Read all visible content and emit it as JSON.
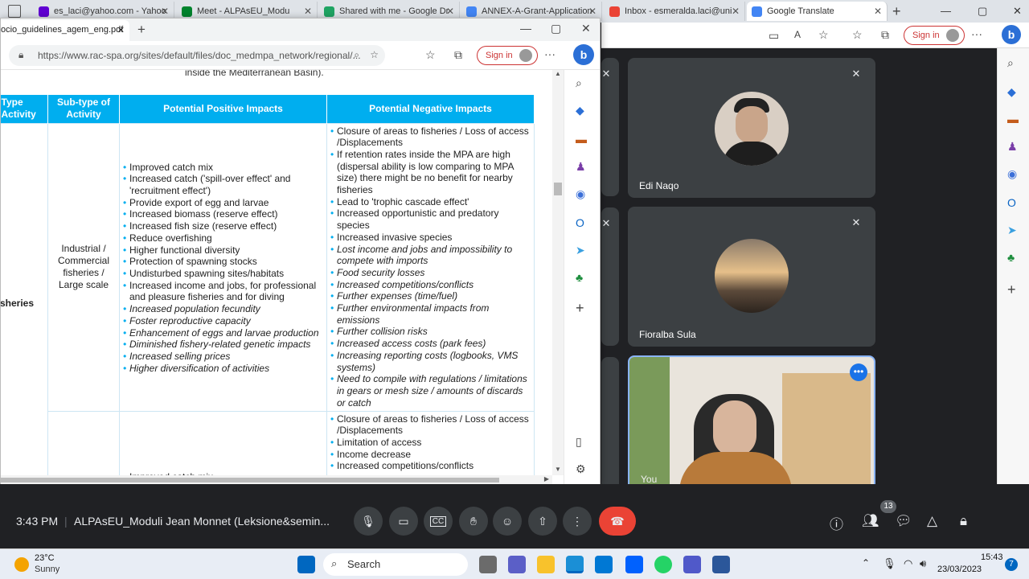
{
  "tabs": [
    {
      "label": "es_laci@yahoo.com - Yahoo",
      "icon": "yahoo-mail-icon",
      "color": "#6001d2"
    },
    {
      "label": "Meet - ALPAsEU_Modu",
      "icon": "google-meet-icon",
      "color": "#00832d"
    },
    {
      "label": "Shared with me - Google Dr",
      "icon": "google-drive-icon",
      "color": "#1fa463"
    },
    {
      "label": "ANNEX-A-Grant-Application",
      "icon": "google-docs-icon",
      "color": "#4285f4"
    },
    {
      "label": "Inbox - esmeralda.laci@uni",
      "icon": "gmail-icon",
      "color": "#ea4335"
    },
    {
      "label": "Google Translate",
      "icon": "google-translate-icon",
      "color": "#4285f4"
    }
  ],
  "pdf_window": {
    "tab_title": "ocio_guidelines_agem_eng.pdf",
    "url": "https://www.rac-spa.org/sites/default/files/doc_medmpa_network/regional/...",
    "signin": "Sign in",
    "intro_text": "inside the Mediterranean Basin).",
    "headers": [
      "Type Activity",
      "Sub-type of Activity",
      "Potential Positive Impacts",
      "Potential Negative Impacts"
    ],
    "type_label": "sheries",
    "row1": {
      "subtype": "Industrial / Commercial fisheries / Large scale",
      "positive": [
        {
          "t": "Improved catch mix",
          "i": false
        },
        {
          "t": "Increased catch ('spill-over effect' and 'recruitment effect')",
          "i": false
        },
        {
          "t": "Provide export of egg and larvae",
          "i": false
        },
        {
          "t": "Increased biomass (reserve effect)",
          "i": false
        },
        {
          "t": "Increased fish size (reserve effect)",
          "i": false
        },
        {
          "t": "Reduce overfishing",
          "i": false
        },
        {
          "t": "Higher functional diversity",
          "i": false
        },
        {
          "t": "Protection of spawning stocks",
          "i": false
        },
        {
          "t": "Undisturbed spawning sites/habitats",
          "i": false
        },
        {
          "t": "Increased income and jobs, for professional and pleasure fisheries and for diving",
          "i": false
        },
        {
          "t": "Increased population fecundity",
          "i": true
        },
        {
          "t": "Foster reproductive capacity",
          "i": true
        },
        {
          "t": "Enhancement of eggs and larvae production",
          "i": true
        },
        {
          "t": "Diminished fishery-related genetic impacts",
          "i": true
        },
        {
          "t": "Increased selling prices",
          "i": true
        },
        {
          "t": "Higher diversification of activities",
          "i": true
        }
      ],
      "negative": [
        {
          "t": "Closure of areas to fisheries / Loss of access /Displacements",
          "i": false
        },
        {
          "t": "If retention rates inside the MPA are high (dispersal ability is low comparing to MPA size) there might be no benefit for nearby fisheries",
          "i": false
        },
        {
          "t": "Lead to 'trophic cascade effect'",
          "i": false
        },
        {
          "t": "Increased opportunistic and predatory species",
          "i": false
        },
        {
          "t": "Increased invasive species",
          "i": false
        },
        {
          "t": "Lost income and jobs and impossibility to compete with imports",
          "i": true
        },
        {
          "t": "Food security losses",
          "i": true
        },
        {
          "t": "Increased competitions/conflicts",
          "i": true
        },
        {
          "t": "Further expenses (time/fuel)",
          "i": true
        },
        {
          "t": "Further environmental impacts from emissions",
          "i": true
        },
        {
          "t": "Further collision risks",
          "i": true
        },
        {
          "t": "Increased access costs (park fees)",
          "i": true
        },
        {
          "t": "Increasing reporting costs (logbooks, VMS systems)",
          "i": true
        },
        {
          "t": "Need to compile with regulations / limitations in gears or mesh size / amounts of discards or catch",
          "i": true
        }
      ]
    },
    "row2": {
      "positive": [
        {
          "t": "Improved catch mix",
          "i": false
        }
      ],
      "negative": [
        {
          "t": "Closure of areas to fisheries / Loss of access /Displacements",
          "i": false
        },
        {
          "t": "Limitation of access",
          "i": false
        },
        {
          "t": "Income decrease",
          "i": false
        },
        {
          "t": "Increased competitions/conflicts",
          "i": false
        }
      ]
    }
  },
  "main_browser": {
    "signin": "Sign in"
  },
  "meet": {
    "participants": [
      {
        "name": "Edi Naqo"
      },
      {
        "name": "Fioralba Sula"
      },
      {
        "name": "You"
      }
    ],
    "time": "3:43 PM",
    "meeting_title": "ALPAsEU_Moduli Jean Monnet (Leksione&semin...",
    "people_count": "13"
  },
  "taskbar": {
    "temp": "23°C",
    "weather": "Sunny",
    "search": "Search",
    "clock_time": "15:43",
    "clock_date": "23/03/2023",
    "notif": "7"
  },
  "colors": {
    "accent": "#00aeef",
    "end_call": "#ea4335",
    "meet_bg": "#202124"
  }
}
